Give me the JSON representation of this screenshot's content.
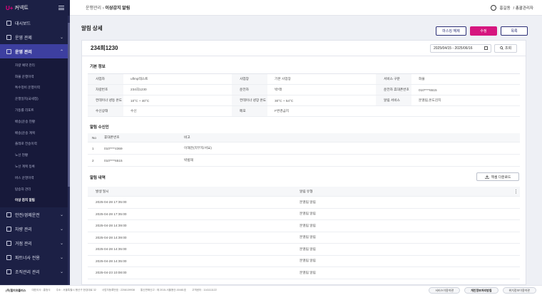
{
  "brand": {
    "mark": "U+",
    "name": "커넥트"
  },
  "sidebar": {
    "items": [
      {
        "label": "대시보드",
        "icon": "dashboard-icon",
        "chevron": false
      },
      {
        "label": "운영 관제",
        "icon": "monitor-icon",
        "chevron": true
      }
    ],
    "active": {
      "label": "운영 관리",
      "icon": "truck-icon"
    },
    "sub_items": [
      "차량 예약 관리",
      "화물 운행이력",
      "특수정비 운행이력",
      "운행일지(국세청)",
      "가동률 리포트",
      "배송(운송 현황",
      "배송(운송 계획",
      "플레로 전송이력",
      "노선 현황",
      "노선 계획 등록",
      "버스 운영이력",
      "탑승자 관리",
      "이상 감지 알림"
    ],
    "current_sub": 12,
    "bottom_items": [
      {
        "label": "안전/경제운전",
        "icon": "shield-icon"
      },
      {
        "label": "차량 관리",
        "icon": "car-icon"
      },
      {
        "label": "거점 관리",
        "icon": "pin-icon"
      },
      {
        "label": "파트너사 전용",
        "icon": "partner-icon"
      },
      {
        "label": "조직관리 관리",
        "icon": "org-icon"
      }
    ]
  },
  "topbar": {
    "breadcrumb_parent": "운행관리",
    "breadcrumb_sep": " › ",
    "breadcrumb_current": "이상감지 알림",
    "user_name": "홍길동",
    "user_role": "/ 총괄관리자"
  },
  "page": {
    "title": "알림 상세",
    "buttons": {
      "master": "마스킹 해제",
      "edit": "수정",
      "list": "목록"
    }
  },
  "detail": {
    "title": "234희1230",
    "date_range": "2025/04/15 - 2025/06/16",
    "search_label": "조회"
  },
  "basic_info": {
    "title": "기본 정보",
    "rows": [
      [
        {
          "k": "사업자",
          "v": "uflmp테스트"
        },
        {
          "k": "사업장",
          "v": "기본 사업장"
        },
        {
          "k": "서비스 구분",
          "v": "화물"
        }
      ],
      [
        {
          "k": "차량번호",
          "v": "234희1230"
        },
        {
          "k": "운전자",
          "v": "박*래"
        },
        {
          "k": "운전자 휴대폰번호",
          "v": "010****6515"
        }
      ],
      [
        {
          "k": "컨테이너 냉동 온도",
          "v": "10°C ~ 40°C"
        },
        {
          "k": "컨테이너 냉장 온도",
          "v": "30°C ~ 54°C"
        },
        {
          "k": "알림 서비스",
          "v": "문열림,온도감지"
        }
      ],
      [
        {
          "k": "수신상태",
          "v": "수신"
        },
        {
          "k": "메모",
          "v": "F변경금지"
        }
      ]
    ]
  },
  "recipients": {
    "title": "알림 수신인",
    "headers": {
      "no": "No",
      "phone": "휴대폰번호",
      "note": "비고"
    },
    "rows": [
      {
        "no": "1",
        "phone": "010****4369",
        "note": "이해관(지무지/서요)"
      },
      {
        "no": "2",
        "phone": "010****6515",
        "note": "박범재"
      }
    ]
  },
  "history": {
    "title": "알림 내역",
    "excel_label": "엑셀 다운로드",
    "headers": {
      "time": "발생 일시",
      "type": "알림 유형"
    },
    "rows": [
      {
        "time": "2025-04-28 17:35:00",
        "type": "문열림 알림"
      },
      {
        "time": "2025-04-28 17:35:00",
        "type": "문열림 알림"
      },
      {
        "time": "2025-04-28 14:39:00",
        "type": "문열림 알림"
      },
      {
        "time": "2025-04-28 14:39:00",
        "type": "문열림 알림"
      },
      {
        "time": "2025-04-28 14:35:00",
        "type": "문열림 알림"
      },
      {
        "time": "2025-04-28 14:35:00",
        "type": "문열림 알림"
      },
      {
        "time": "2025-04-23 10:08:00",
        "type": "문열림 알림"
      }
    ]
  },
  "footer": {
    "company": "(주)엘지유플러스",
    "info": [
      "대표이사 : 홍범식",
      "주소 : 서울특별시 용산구 한강대로 32",
      "사업자등록번호 : 2208139938",
      "통신판매신고 : 제 2015-서울용산-00481호",
      "고객센터 : 1141111122"
    ],
    "links": [
      {
        "label": "서비스이용약관",
        "bold": false
      },
      {
        "label": "개인정보처리방침",
        "bold": true
      },
      {
        "label": "위치정보이용약관",
        "bold": false
      }
    ]
  },
  "colors": {
    "sidebar_bg": "#1c2045",
    "active_bg": "#3d3fa0",
    "accent": "#d6167f",
    "navy": "#2b2f76"
  }
}
